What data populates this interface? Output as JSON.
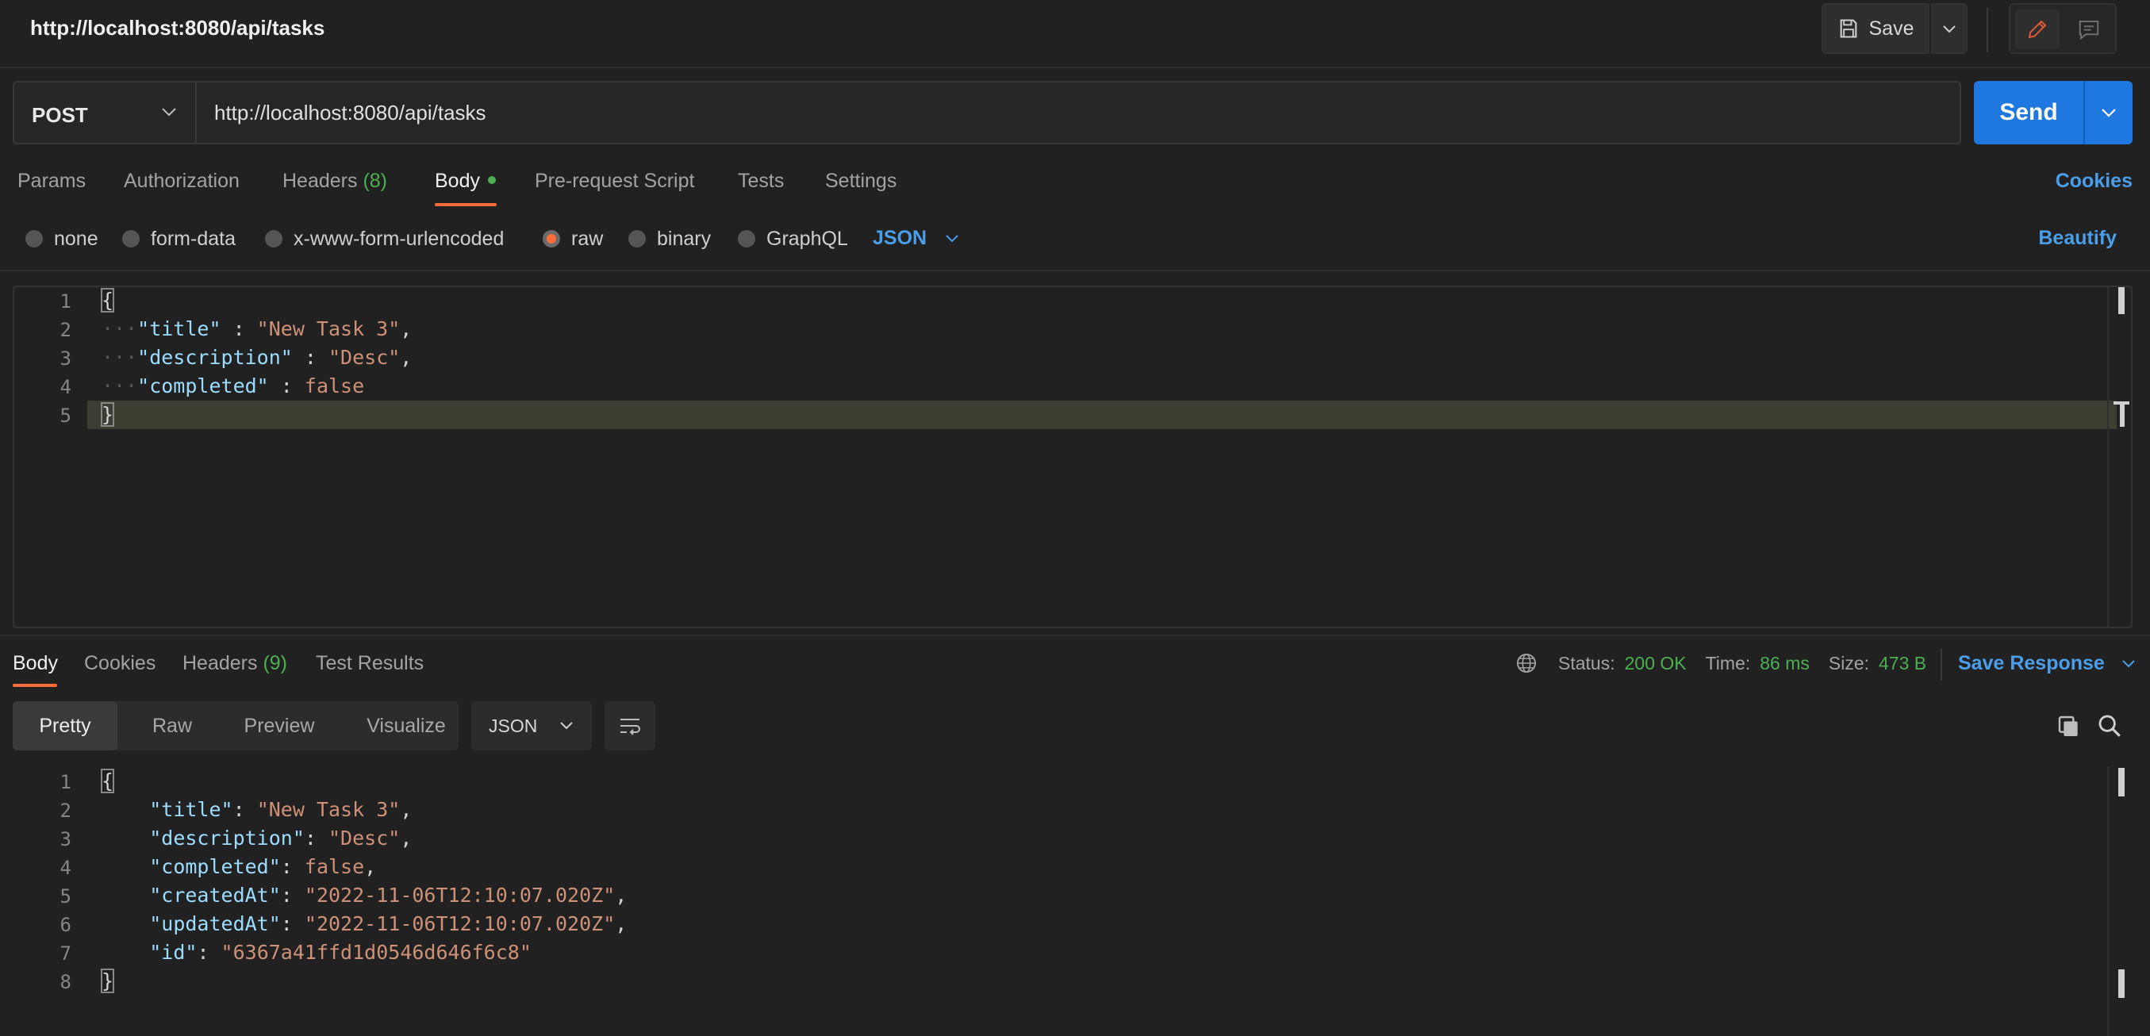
{
  "request": {
    "title": "http://localhost:8080/api/tasks",
    "save_label": "Save",
    "method": "POST",
    "url": "http://localhost:8080/api/tasks",
    "send_label": "Send",
    "tabs": [
      {
        "label": "Params"
      },
      {
        "label": "Authorization"
      },
      {
        "label": "Headers",
        "count": "(8)"
      },
      {
        "label": "Body"
      },
      {
        "label": "Pre-request Script"
      },
      {
        "label": "Tests"
      },
      {
        "label": "Settings"
      }
    ],
    "cookies_label": "Cookies",
    "body_types": [
      "none",
      "form-data",
      "x-www-form-urlencoded",
      "raw",
      "binary",
      "GraphQL"
    ],
    "selected_body_type": "raw",
    "language": "JSON",
    "beautify_label": "Beautify",
    "line_numbers": [
      "1",
      "2",
      "3",
      "4",
      "5"
    ],
    "body_lines": {
      "l1": "{",
      "l2_key": "\"title\"",
      "l2_sep": " : ",
      "l2_val": "\"New Task 3\"",
      "l3_key": "\"description\"",
      "l3_sep": " : ",
      "l3_val": "\"Desc\"",
      "l4_key": "\"completed\"",
      "l4_sep": " : ",
      "l4_val": "false",
      "l5": "}"
    }
  },
  "response": {
    "tabs": [
      {
        "label": "Body"
      },
      {
        "label": "Cookies"
      },
      {
        "label": "Headers",
        "count": "(9)"
      },
      {
        "label": "Test Results"
      }
    ],
    "status_label": "Status:",
    "status_value": "200 OK",
    "time_label": "Time:",
    "time_value": "86 ms",
    "size_label": "Size:",
    "size_value": "473 B",
    "save_response_label": "Save Response",
    "views": [
      "Pretty",
      "Raw",
      "Preview",
      "Visualize"
    ],
    "language": "JSON",
    "line_numbers": [
      "1",
      "2",
      "3",
      "4",
      "5",
      "6",
      "7",
      "8"
    ],
    "body_lines": {
      "l1": "{",
      "l2_key": "\"title\"",
      "l2_val": "\"New Task 3\"",
      "l3_key": "\"description\"",
      "l3_val": "\"Desc\"",
      "l4_key": "\"completed\"",
      "l4_val": "false",
      "l5_key": "\"createdAt\"",
      "l5_val": "\"2022-11-06T12:10:07.020Z\"",
      "l6_key": "\"updatedAt\"",
      "l6_val": "\"2022-11-06T12:10:07.020Z\"",
      "l7_key": "\"id\"",
      "l7_val": "\"6367a41ffd1d0546d646f6c8\"",
      "l8": "}"
    }
  },
  "colors": {
    "accent_orange": "#ff6c37",
    "send_blue": "#1f78e0",
    "link_blue": "#4a9eea",
    "success_green": "#4caf50"
  }
}
